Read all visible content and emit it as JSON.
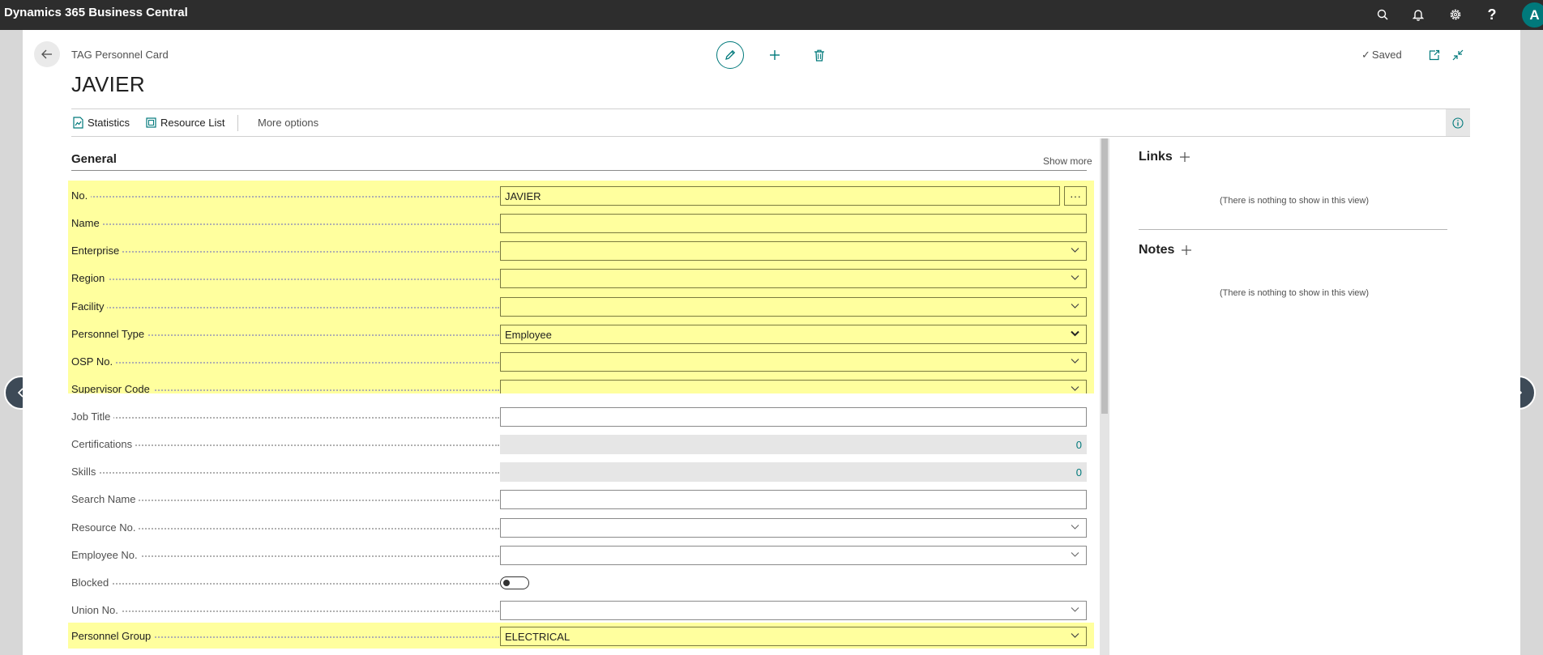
{
  "app": {
    "title": "Dynamics 365 Business Central",
    "avatar_initial": "A"
  },
  "topbar_icons": [
    "search-icon",
    "bell-icon",
    "gear-icon",
    "help-icon"
  ],
  "header": {
    "breadcrumb": "TAG Personnel Card",
    "title": "JAVIER",
    "saved_label": "Saved"
  },
  "actions": {
    "statistics": "Statistics",
    "resource_list": "Resource List",
    "more_options": "More options"
  },
  "general": {
    "title": "General",
    "show_more": "Show more",
    "fields": {
      "no": {
        "label": "No.",
        "value": "JAVIER"
      },
      "name": {
        "label": "Name",
        "value": ""
      },
      "enterprise": {
        "label": "Enterprise",
        "value": ""
      },
      "region": {
        "label": "Region",
        "value": ""
      },
      "facility": {
        "label": "Facility",
        "value": ""
      },
      "personnel_type": {
        "label": "Personnel Type",
        "value": "Employee"
      },
      "osp_no": {
        "label": "OSP No.",
        "value": ""
      },
      "supervisor_code": {
        "label": "Supervisor Code",
        "value": ""
      },
      "job_title": {
        "label": "Job Title",
        "value": ""
      },
      "certifications": {
        "label": "Certifications",
        "value": "0"
      },
      "skills": {
        "label": "Skills",
        "value": "0"
      },
      "search_name": {
        "label": "Search Name",
        "value": ""
      },
      "resource_no": {
        "label": "Resource No.",
        "value": ""
      },
      "employee_no": {
        "label": "Employee No.",
        "value": ""
      },
      "blocked": {
        "label": "Blocked",
        "value": false
      },
      "union_no": {
        "label": "Union No.",
        "value": ""
      },
      "personnel_group": {
        "label": "Personnel Group",
        "value": "ELECTRICAL"
      }
    }
  },
  "factbox": {
    "links_title": "Links",
    "links_empty": "(There is nothing to show in this view)",
    "notes_title": "Notes",
    "notes_empty": "(There is nothing to show in this view)"
  },
  "colors": {
    "highlight": "#ffff9e",
    "accent": "#00797b",
    "topbar": "#2d2d2d"
  }
}
